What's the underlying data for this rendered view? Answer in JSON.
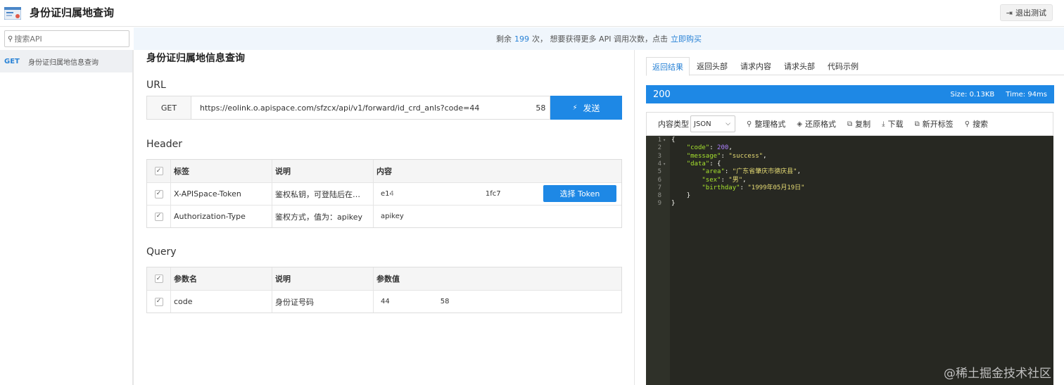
{
  "header": {
    "title": "身份证归属地查询",
    "exit_label": "退出测试"
  },
  "search": {
    "placeholder": "搜索API"
  },
  "notice": {
    "prefix": "剩余",
    "count": "199",
    "mid": "次， 想要获得更多 API 调用次数，点击",
    "link": "立即购买"
  },
  "sidebar": {
    "items": [
      {
        "method": "GET",
        "label": "身份证归属地信息查询"
      }
    ]
  },
  "main": {
    "title": "身份证归属地信息查询",
    "url_label": "URL",
    "method": "GET",
    "url": "https://eolink.o.apispace.com/sfzcx/api/v1/forward/id_crd_anls?code=44",
    "url_tail": "58",
    "send_label": "发送",
    "header_label": "Header",
    "header_table": {
      "columns": [
        "标签",
        "说明",
        "内容"
      ],
      "rows": [
        {
          "label": "X-APISpace-Token",
          "desc": "鉴权私钥，可登陆后在…",
          "value_head": "e14",
          "value_tail": "1fc7",
          "button": "选择 Token"
        },
        {
          "label": "Authorization-Type",
          "desc": "鉴权方式，值为：apikey",
          "value_head": "apikey",
          "value_tail": ""
        }
      ]
    },
    "query_label": "Query",
    "query_table": {
      "columns": [
        "参数名",
        "说明",
        "参数值"
      ],
      "rows": [
        {
          "label": "code",
          "desc": "身份证号码",
          "value_head": "44",
          "value_tail": "58"
        }
      ]
    }
  },
  "result": {
    "tabs": [
      "返回结果",
      "返回头部",
      "请求内容",
      "请求头部",
      "代码示例"
    ],
    "status": "200",
    "size": "Size: 0.13KB",
    "time": "Time: 94ms",
    "content_type_label": "内容类型",
    "content_type_value": "JSON",
    "tools": [
      "整理格式",
      "还原格式",
      "复制",
      "下载",
      "新开标签",
      "搜索"
    ]
  },
  "watermark": "@稀土掘金技术社区"
}
